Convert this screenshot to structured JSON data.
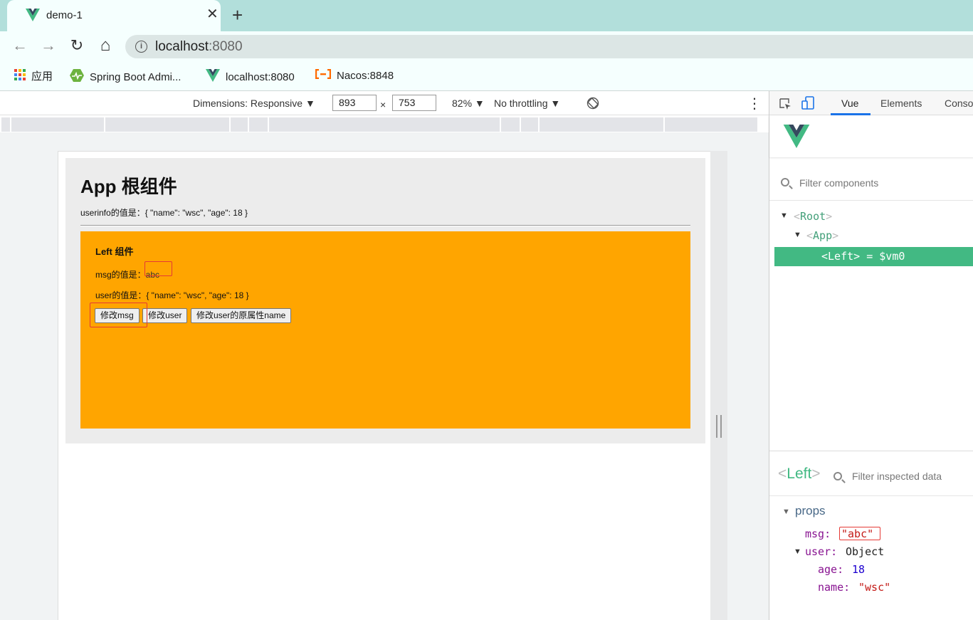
{
  "browser": {
    "tab": {
      "title": "demo-1",
      "close": "✕",
      "new_tab": "+"
    },
    "nav": {
      "back": "←",
      "forward": "→",
      "reload": "↻",
      "home": "⌂"
    },
    "address": {
      "host": "localhost",
      "port": ":8080",
      "info_icon": "i"
    },
    "bookmarks": [
      {
        "label": "应用",
        "icon": "apps-grid-icon"
      },
      {
        "label": "Spring Boot Admi...",
        "icon": "spring-boot-icon"
      },
      {
        "label": "localhost:8080",
        "icon": "vue-logo-icon"
      },
      {
        "label": "Nacos:8848",
        "icon": "nacos-icon"
      }
    ]
  },
  "device_toolbar": {
    "dimensions_label": "Dimensions: Responsive ▼",
    "width": "893",
    "times": "×",
    "height": "753",
    "zoom": "82% ▼",
    "throttling": "No throttling ▼",
    "more": "⋮"
  },
  "page": {
    "app_title": "App 根组件",
    "userinfo_text": "userinfo的值是：{ \"name\": \"wsc\", \"age\": 18 }",
    "left": {
      "title": "Left 组件",
      "msg_label": "msg的值是：",
      "msg_value": "abc",
      "user_text": "user的值是：{ \"name\": \"wsc\", \"age\": 18 }",
      "buttons": [
        "修改msg",
        "修改user",
        "修改user的原属性name"
      ]
    }
  },
  "devtools": {
    "tabs": [
      "Vue",
      "Elements",
      "Conso"
    ],
    "active_tab": "Vue",
    "filter_components_placeholder": "Filter components",
    "tree": {
      "root": "Root",
      "app": "App",
      "selected": "Left",
      "selected_ref": "= $vm0"
    },
    "inspected": {
      "component": "Left",
      "filter_placeholder": "Filter inspected data",
      "section": "props",
      "msg_key": "msg:",
      "msg_value": "\"abc\"",
      "user_key": "user:",
      "user_type": "Object",
      "age_key": "age:",
      "age_value": "18",
      "name_key": "name:",
      "name_value": "\"wsc\""
    }
  },
  "colors": {
    "tabstrip": "#b2dfdb",
    "vue_green": "#42b983",
    "left_component_bg": "#ffa500",
    "highlight_red": "#e53935"
  }
}
